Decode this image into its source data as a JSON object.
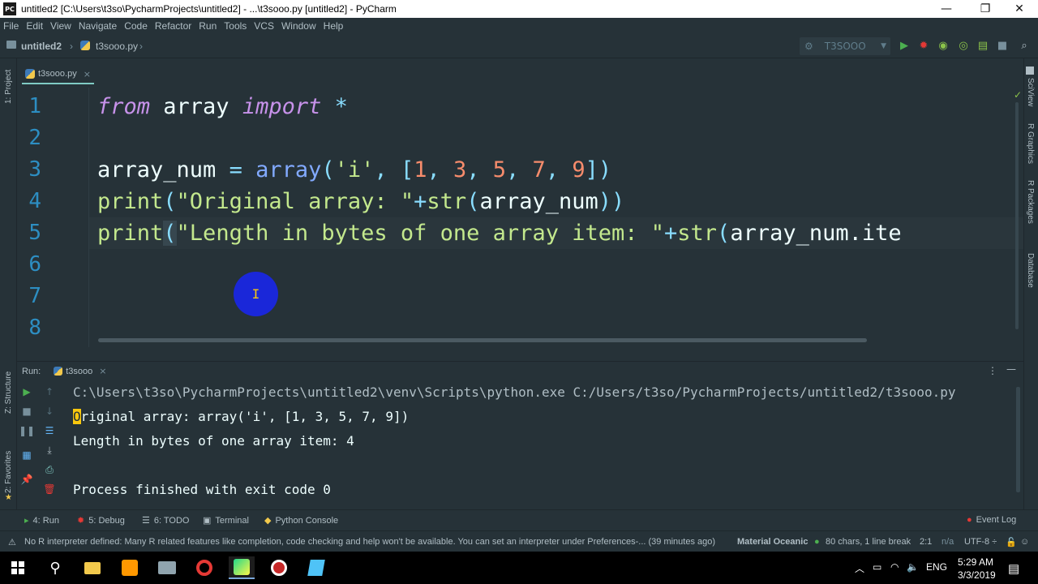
{
  "window": {
    "title": "untitled2 [C:\\Users\\t3so\\PycharmProjects\\untitled2] - ...\\t3sooo.py [untitled2] - PyCharm",
    "app_icon_text": "PC",
    "minimize": "—",
    "restore": "❐",
    "close": "✕"
  },
  "menu": [
    "File",
    "Edit",
    "View",
    "Navigate",
    "Code",
    "Refactor",
    "Run",
    "Tools",
    "VCS",
    "Window",
    "Help"
  ],
  "navbar": {
    "project": "untitled2",
    "file": "t3sooo.py",
    "run_config": "T3SOOO"
  },
  "left_strip": {
    "project": "1: Project",
    "structure": "Z: Structure",
    "favorites": "2: Favorites"
  },
  "right_strip": {
    "sciview": "SciView",
    "rgraphics": "R Graphics",
    "rpackages": "R Packages",
    "database": "Database"
  },
  "editor": {
    "tab_label": "t3sooo.py",
    "tab_close": "×",
    "line_numbers": [
      "1",
      "2",
      "3",
      "4",
      "5",
      "6",
      "7",
      "8"
    ],
    "line1": {
      "kw1": "from",
      "mod": " array ",
      "kw2": "import",
      "star": " *"
    },
    "line3": {
      "a": "array_num ",
      "eq": "=",
      "b": " ",
      "fn": "array",
      "p1": "(",
      "s": "'i'",
      "c1": ", ",
      "br1": "[",
      "n1": "1",
      "c2": ", ",
      "n2": "3",
      "c3": ", ",
      "n3": "5",
      "c4": ", ",
      "n4": "7",
      "c5": ", ",
      "n5": "9",
      "br2": "]",
      "p2": ")"
    },
    "line4": {
      "fn": "print",
      "p1": "(",
      "s": "\"Original array: \"",
      "plus": "+",
      "f2": "str",
      "p2": "(",
      "arg": "array_num",
      "p3": "))"
    },
    "line5": {
      "fn": "print",
      "p1": "(",
      "s": "\"Length in bytes of one array item: \"",
      "plus": "+",
      "f2": "str",
      "p2": "(",
      "arg": "array_num.ite"
    },
    "cursor_glyph": "I"
  },
  "run_panel": {
    "label": "Run:",
    "tab": "t3sooo",
    "tab_close": "×",
    "lines": [
      "C:\\Users\\t3so\\PycharmProjects\\untitled2\\venv\\Scripts\\python.exe C:/Users/t3so/PycharmProjects/untitled2/t3sooo.py",
      "Original array: array('i', [1, 3, 5, 7, 9])",
      "Length in bytes of one array item: 4",
      "",
      "Process finished with exit code 0"
    ],
    "line2_first": "O",
    "line2_rest": "riginal array: array('i', [1, 3, 5, 7, 9])"
  },
  "bottom_tabs": {
    "run": "4: Run",
    "debug": "5: Debug",
    "todo": "6: TODO",
    "terminal": "Terminal",
    "console": "Python Console",
    "eventlog": "Event Log"
  },
  "status": {
    "message": "No R interpreter defined: Many R related features like completion, code checking and help won't be available. You can set an interpreter under Preferences-... (39 minutes ago)",
    "theme": "Material Oceanic",
    "chars": "80 chars, 1 line break",
    "pos": "2:1",
    "na": "n/a",
    "encoding": "UTF-8 ÷"
  },
  "taskbar": {
    "lang": "ENG",
    "time": "5:29 AM",
    "date": "3/3/2019"
  }
}
